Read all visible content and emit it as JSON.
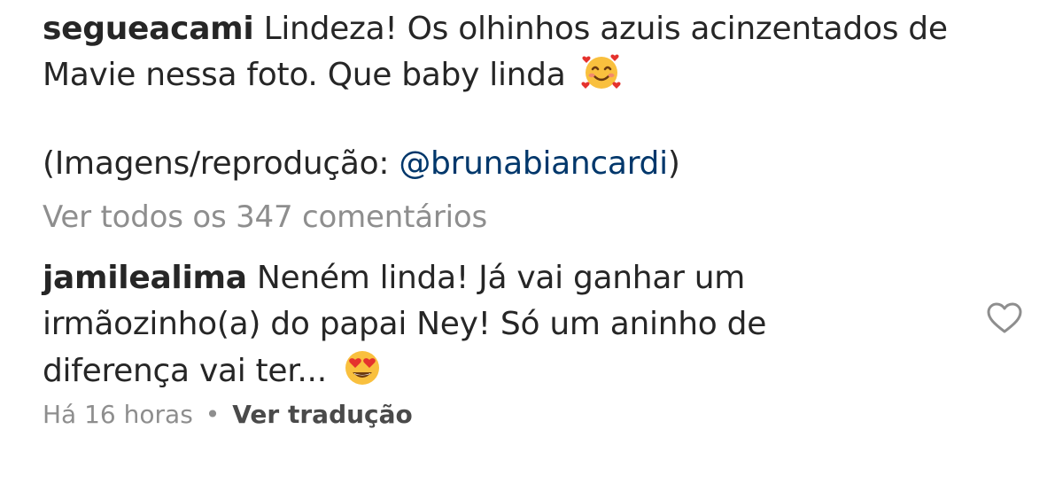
{
  "caption": {
    "username": "segueacami",
    "text": "Lindeza! Os olhinhos  azuis acinzentados de Mavie nessa foto. Que baby linda",
    "emoji_icon": "smiling-face-with-hearts-icon",
    "credit_prefix": "(Imagens/reprodução: ",
    "credit_mention": "@brunabiancardi",
    "credit_suffix": ")"
  },
  "comments_link": {
    "label": "Ver todos os 347 comentários"
  },
  "comment": {
    "username": "jamilealima",
    "text": "Neném linda! Já vai ganhar um irmãozinho(a) do papai Ney! Só um aninho de diferença vai ter...",
    "emoji_icon": "heart-eyes-icon",
    "like_icon": "heart-outline-icon",
    "time": "Há 16 horas",
    "separator": "•",
    "translate_label": "Ver tradução"
  },
  "colors": {
    "text": "#262626",
    "secondary": "#8e8e8e",
    "mention": "#00376b",
    "emoji_yellow": "#f9c03e",
    "emoji_heart": "#e5322d"
  }
}
